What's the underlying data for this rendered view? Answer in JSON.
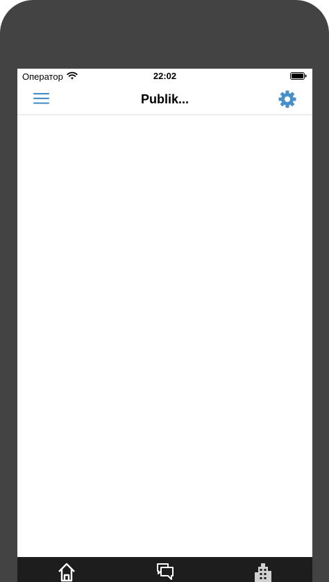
{
  "status_bar": {
    "carrier": "Оператор",
    "time": "22:02"
  },
  "nav_bar": {
    "title": "Publik...",
    "menu_icon": "hamburger-menu-icon",
    "settings_icon": "gear-icon"
  },
  "tab_bar": {
    "tabs": [
      {
        "icon": "home-icon"
      },
      {
        "icon": "chat-icon"
      },
      {
        "icon": "building-icon"
      }
    ]
  },
  "colors": {
    "accent": "#4a90c8",
    "device_frame": "#434343",
    "tab_bar": "#1d1d1d"
  }
}
